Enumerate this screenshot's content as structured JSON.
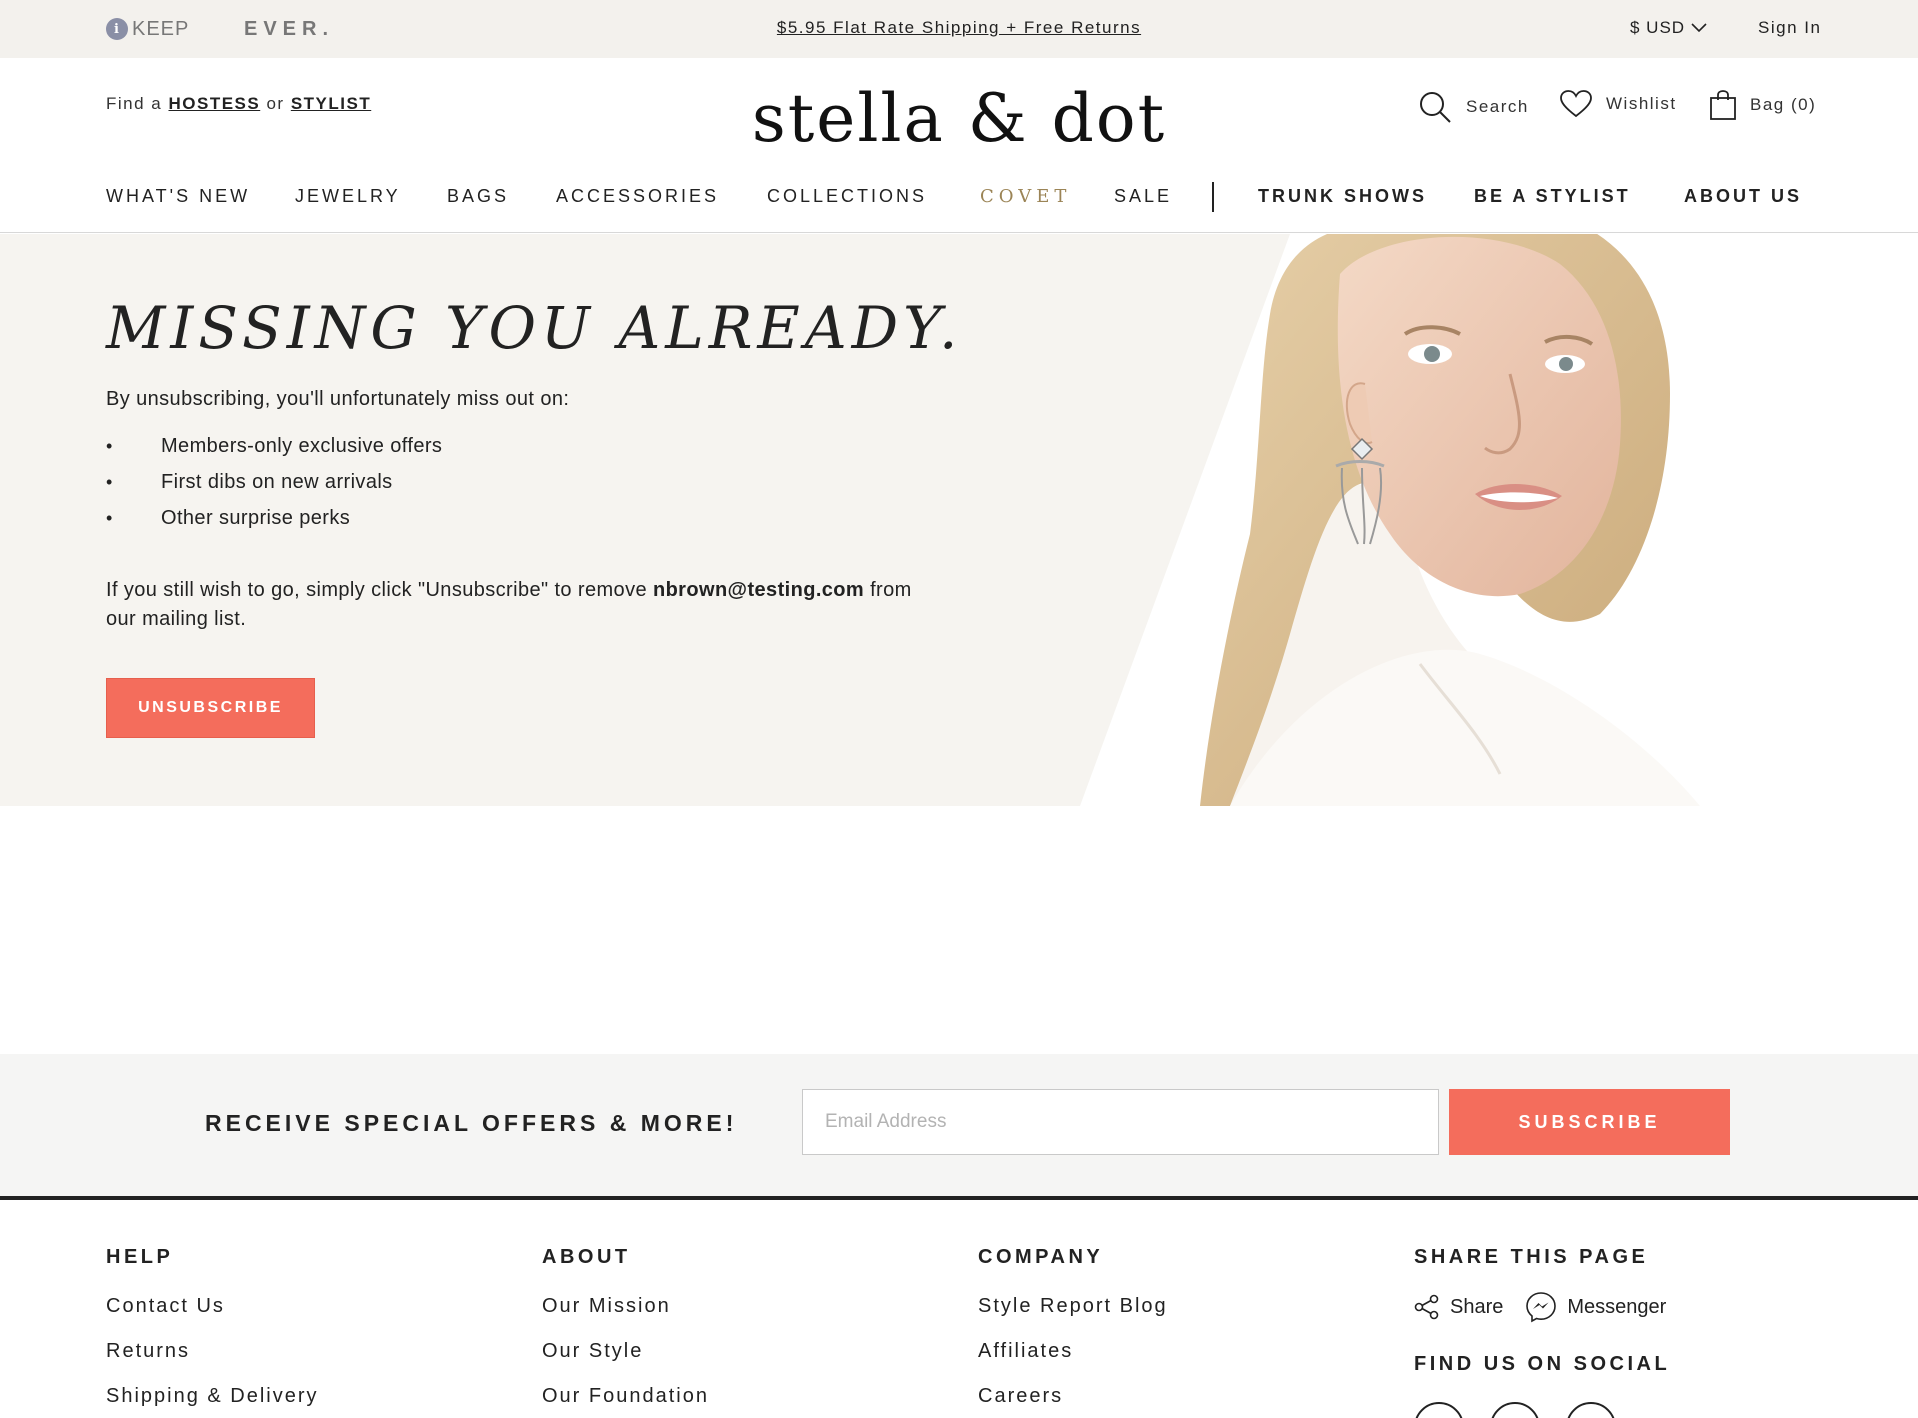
{
  "topbar": {
    "keep_brand": "KEEP",
    "keep_badge": "i",
    "ever_brand": "EVER.",
    "promo": "$5.95 Flat Rate Shipping + Free Returns",
    "currency": "$ USD",
    "sign_in": "Sign In"
  },
  "header": {
    "find_prefix": "Find a",
    "hostess": "HOSTESS",
    "find_or": "or",
    "stylist": "STYLIST",
    "logo": "stella & dot",
    "search": "Search",
    "wishlist": "Wishlist",
    "bag": "Bag (0)"
  },
  "nav": {
    "whats_new": "WHAT'S NEW",
    "jewelry": "JEWELRY",
    "bags": "BAGS",
    "accessories": "ACCESSORIES",
    "collections": "COLLECTIONS",
    "covet": "COVET",
    "sale": "SALE",
    "trunk_shows": "TRUNK SHOWS",
    "be_a_stylist": "BE A STYLIST",
    "about_us": "ABOUT US"
  },
  "hero": {
    "title": "MISSING YOU ALREADY.",
    "intro": "By unsubscribing, you'll unfortunately miss out on:",
    "perks": [
      "Members-only exclusive offers",
      "First dibs on new arrivals",
      "Other surprise perks"
    ],
    "leave_before": "If you still wish to go, simply click \"Unsubscribe\" to remove ",
    "email": "nbrown@testing.com",
    "leave_after": " from our mailing list.",
    "unsubscribe": "UNSUBSCRIBE"
  },
  "newsletter": {
    "label": "RECEIVE SPECIAL OFFERS & MORE!",
    "placeholder": "Email Address",
    "subscribe": "SUBSCRIBE"
  },
  "footer": {
    "help": {
      "title": "HELP",
      "links": [
        "Contact Us",
        "Returns",
        "Shipping & Delivery"
      ]
    },
    "about": {
      "title": "ABOUT",
      "links": [
        "Our Mission",
        "Our Style",
        "Our Foundation"
      ]
    },
    "company": {
      "title": "COMPANY",
      "links": [
        "Style Report Blog",
        "Affiliates",
        "Careers"
      ]
    },
    "share": {
      "title": "SHARE THIS PAGE",
      "share": "Share",
      "messenger": "Messenger",
      "social_title": "FIND US ON SOCIAL"
    }
  },
  "colors": {
    "accent": "#f46d5c",
    "topbar_bg": "#f3f1ed",
    "hero_bg": "#f6f4f0",
    "covet": "#9b8456"
  },
  "icons": [
    "search-icon",
    "heart-icon",
    "bag-icon",
    "chevron-down-icon",
    "share-icon",
    "messenger-icon"
  ]
}
